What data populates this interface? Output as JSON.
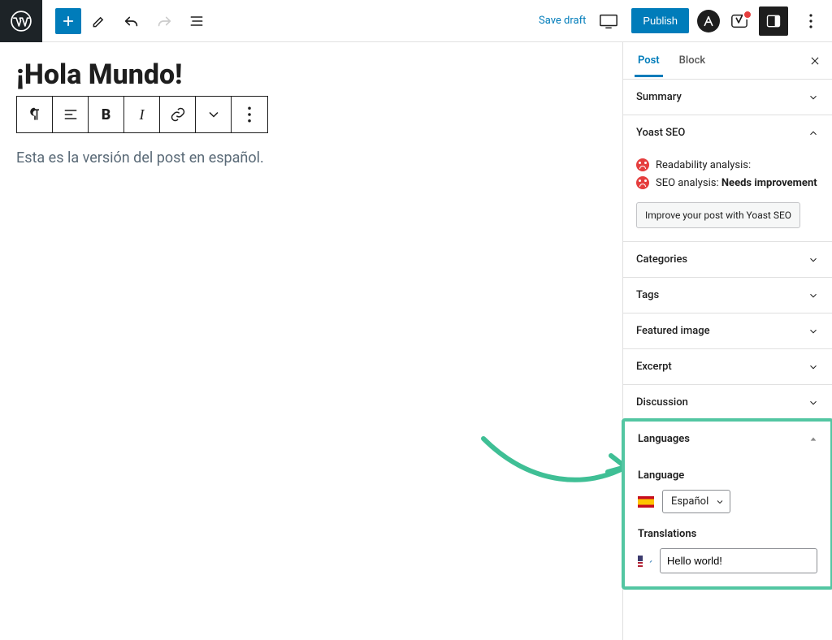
{
  "topbar": {
    "save_draft": "Save draft",
    "publish": "Publish"
  },
  "post": {
    "title": "¡Hola Mundo!",
    "body": "Esta es la versión del post en español."
  },
  "sidebar": {
    "tabs": {
      "post": "Post",
      "block": "Block"
    },
    "panels": {
      "summary": "Summary",
      "yoast": "Yoast SEO",
      "categories": "Categories",
      "tags": "Tags",
      "featured": "Featured image",
      "excerpt": "Excerpt",
      "discussion": "Discussion",
      "languages": "Languages"
    },
    "yoast": {
      "readability_label": "Readability analysis:",
      "seo_label": "SEO analysis:",
      "seo_value": "Needs improvement",
      "button": "Improve your post with Yoast SEO"
    },
    "languages": {
      "language_label": "Language",
      "selected": "Español",
      "translations_label": "Translations",
      "translation_value": "Hello world!"
    }
  }
}
